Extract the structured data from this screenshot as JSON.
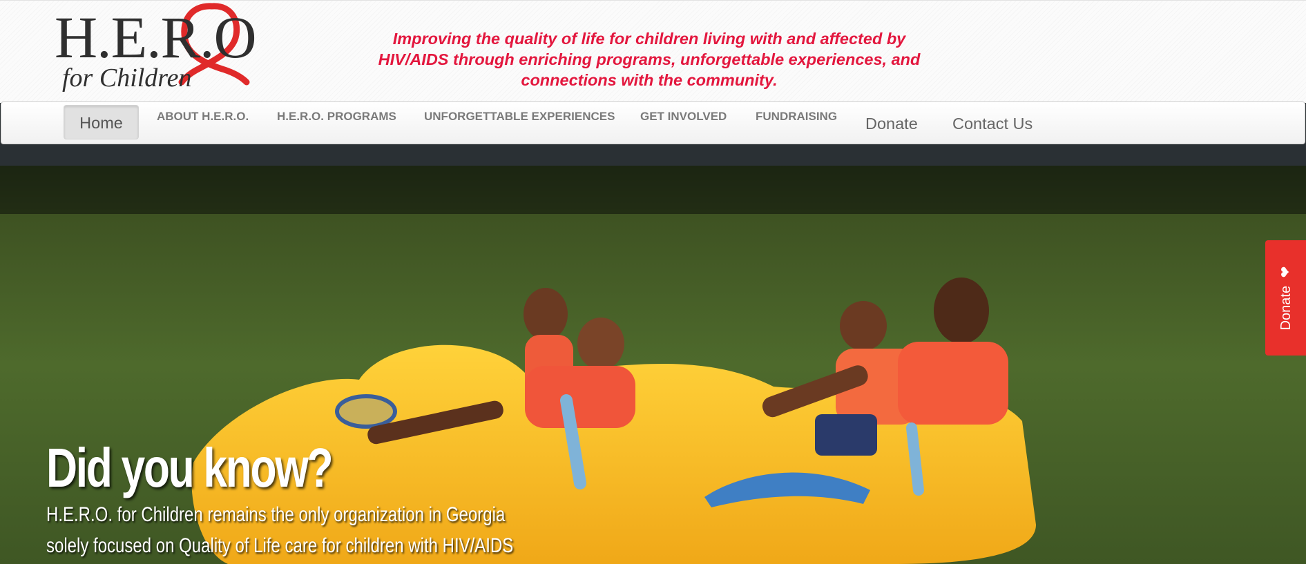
{
  "header": {
    "logo_main": "H.E.R.O",
    "logo_sub": "for Children",
    "tagline_1": "Improving the quality of life for children living with and affected by",
    "tagline_2": "HIV/AIDS through enriching programs, unforgettable experiences, and",
    "tagline_3": "connections with the community."
  },
  "nav": {
    "items": [
      {
        "label": "Home"
      },
      {
        "label": "ABOUT H.E.R.O."
      },
      {
        "label": "H.E.R.O. PROGRAMS"
      },
      {
        "label": "UNFORGETTABLE EXPERIENCES"
      },
      {
        "label": "GET INVOLVED"
      },
      {
        "label": "FUNDRAISING"
      },
      {
        "label": "Donate"
      },
      {
        "label": "Contact Us"
      }
    ]
  },
  "hero": {
    "title": "Did you know?",
    "line_1": "H.E.R.O. for Children remains the only organization in Georgia",
    "line_2": "solely focused on Quality of Life care for children with HIV/AIDS"
  },
  "donate_tab": {
    "label": "Donate",
    "icon": "heart-icon"
  },
  "colors": {
    "accent_red": "#e3173e",
    "donate_red": "#e8302b",
    "nav_text": "#7a7a7a"
  }
}
